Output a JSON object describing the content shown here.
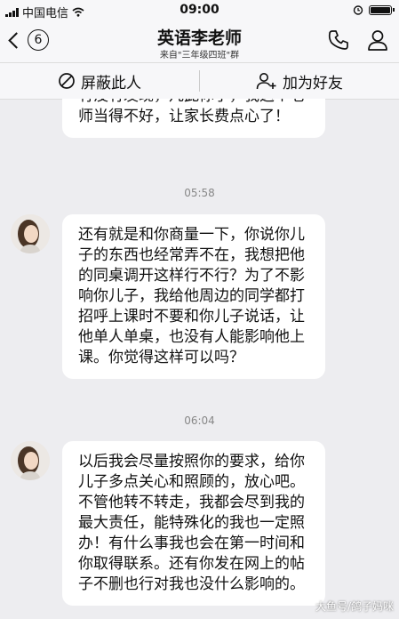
{
  "status_bar": {
    "carrier": "中国电信",
    "time": "09:00"
  },
  "header": {
    "back_count": "6",
    "title": "英语李老师",
    "subtitle": "来自\"三年级四班\"群",
    "phone_icon": "phone-icon",
    "profile_icon": "person-icon"
  },
  "actions": {
    "block_label": "屏蔽此人",
    "add_friend_label": "加为好友"
  },
  "messages": {
    "partial": "有没有发现，凡此你了，我这个老师当得不好，让家长费点心了！",
    "ts1": "05:58",
    "msg1": "还有就是和你商量一下，你说你儿子的东西也经常弄不在，我想把他的同桌调开这样行不行？为了不影响你儿子，我给他周边的同学都打招呼上课时不要和你儿子说话，让他单人单桌，也没有人能影响他上课。你觉得这样可以吗？",
    "ts2": "06:04",
    "msg2": "以后我会尽量按照你的要求，给你儿子多点关心和照顾的，放心吧。不管他转不转走，我都会尽到我的最大责任，能特殊化的我也一定照办！有什么事我也会在第一时间和你取得联系。还有你发在网上的帖子不删也行对我也没什么影响的。"
  },
  "watermark": "大鱼号/鸽子妈咪",
  "colors": {
    "background": "#ededf0",
    "bubble": "#ffffff",
    "bar": "#f7f7f9"
  }
}
